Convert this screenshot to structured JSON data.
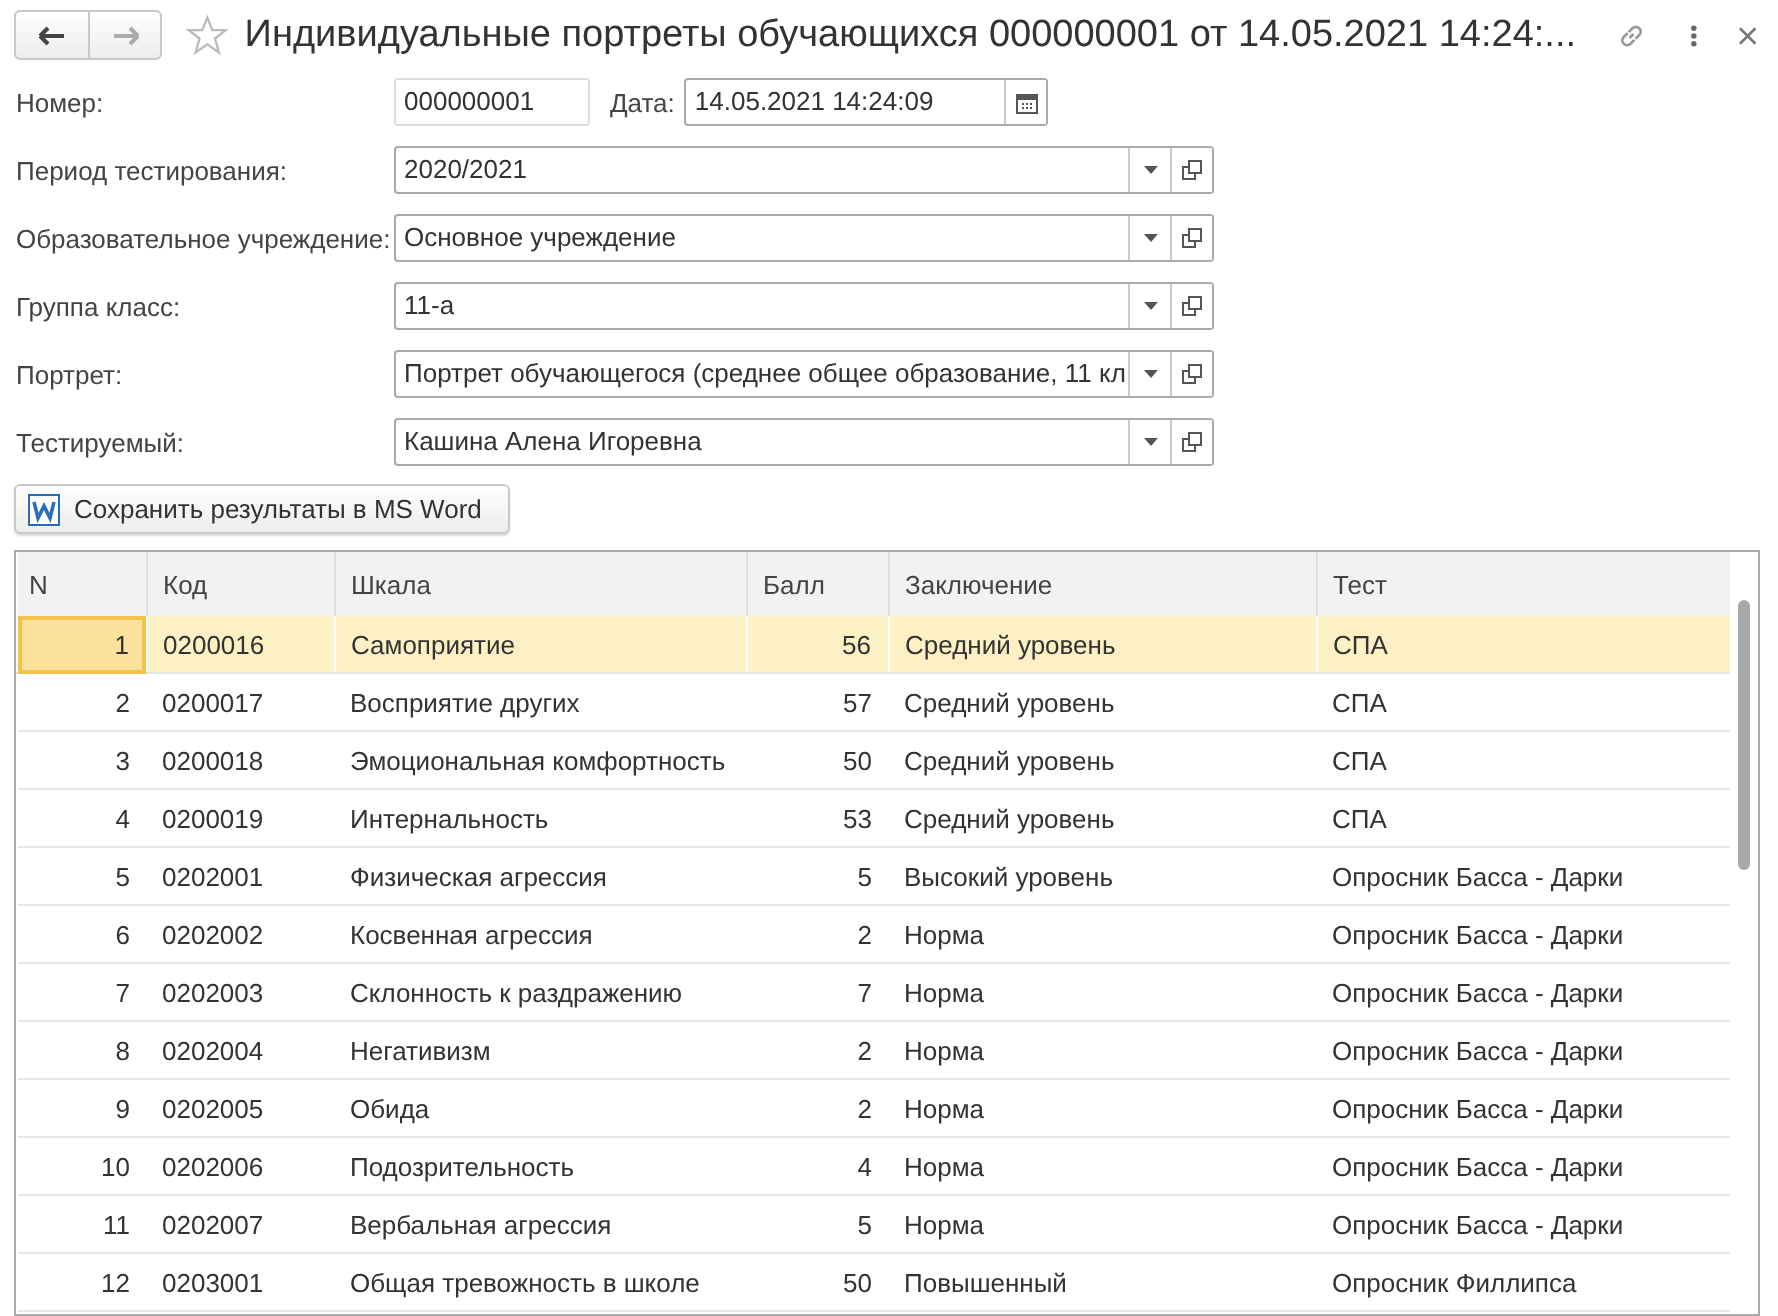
{
  "window": {
    "title": "Индивидуальные портреты обучающихся 000000001 от 14.05.2021 14:24:..."
  },
  "number": {
    "label": "Номер:",
    "value": "000000001"
  },
  "date": {
    "label": "Дата:",
    "value": "14.05.2021 14:24:09"
  },
  "fields": [
    {
      "label": "Период тестирования:",
      "value": "2020/2021"
    },
    {
      "label": "Образовательное учреждение:",
      "value": "Основное учреждение"
    },
    {
      "label": "Группа класс:",
      "value": "11-а"
    },
    {
      "label": "Портрет:",
      "value": "Портрет обучающегося (среднее общее образование, 11 кл"
    },
    {
      "label": "Тестируемый:",
      "value": "Кашина Алена Игоревна"
    }
  ],
  "save_button": "Сохранить результаты в MS Word",
  "table": {
    "columns": [
      "N",
      "Код",
      "Шкала",
      "Балл",
      "Заключение",
      "Тест"
    ],
    "rows": [
      {
        "cells": [
          "1",
          "0200016",
          "Самоприятие",
          "56",
          "Средний уровень",
          "СПА"
        ],
        "selected": true
      },
      {
        "cells": [
          "2",
          "0200017",
          "Восприятие других",
          "57",
          "Средний уровень",
          "СПА"
        ],
        "selected": false
      },
      {
        "cells": [
          "3",
          "0200018",
          "Эмоциональная комфортность",
          "50",
          "Средний уровень",
          "СПА"
        ],
        "selected": false
      },
      {
        "cells": [
          "4",
          "0200019",
          "Интернальность",
          "53",
          "Средний уровень",
          "СПА"
        ],
        "selected": false
      },
      {
        "cells": [
          "5",
          "0202001",
          "Физическая агрессия",
          "5",
          "Высокий уровень",
          "Опросник Басса - Дарки"
        ],
        "selected": false
      },
      {
        "cells": [
          "6",
          "0202002",
          "Косвенная агрессия",
          "2",
          "Норма",
          "Опросник Басса - Дарки"
        ],
        "selected": false
      },
      {
        "cells": [
          "7",
          "0202003",
          "Склонность к раздражению",
          "7",
          "Норма",
          "Опросник Басса - Дарки"
        ],
        "selected": false
      },
      {
        "cells": [
          "8",
          "0202004",
          "Негативизм",
          "2",
          "Норма",
          "Опросник Басса - Дарки"
        ],
        "selected": false
      },
      {
        "cells": [
          "9",
          "0202005",
          "Обида",
          "2",
          "Норма",
          "Опросник Басса - Дарки"
        ],
        "selected": false
      },
      {
        "cells": [
          "10",
          "0202006",
          "Подозрительность",
          "4",
          "Норма",
          "Опросник Басса - Дарки"
        ],
        "selected": false
      },
      {
        "cells": [
          "11",
          "0202007",
          "Вербальная агрессия",
          "5",
          "Норма",
          "Опросник Басса - Дарки"
        ],
        "selected": false
      },
      {
        "cells": [
          "12",
          "0203001",
          "Общая тревожность в школе",
          "50",
          "Повышенный",
          "Опросник Филлипса"
        ],
        "selected": false
      }
    ]
  }
}
